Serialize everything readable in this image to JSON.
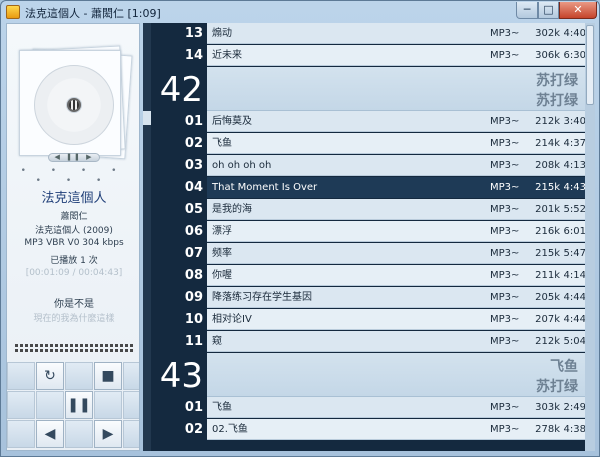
{
  "window": {
    "title": "法克這個人 - 蕭閎仁 [1:09]",
    "minimize": "─",
    "maximize": "□",
    "close": "✕"
  },
  "left": {
    "dots": "• • • • • • •",
    "album_title": "法克這個人",
    "artist": "蕭閎仁",
    "album_year": "法克這個人 (2009)",
    "format": "MP3  VBR V0  304 kbps",
    "plays": "已播放 1 次",
    "faint_line": "[00:01:09 / 00:04:43]",
    "song_name": "你是不是",
    "song_faint": "現在的我為什麼這樣",
    "mini_ctrl": "◀ ❚❚ ▶",
    "controls": {
      "repeat": "↻",
      "stop": "■",
      "pause": "❚❚",
      "prev": "◀",
      "next": "▶"
    }
  },
  "playlist": {
    "top_rows": [
      {
        "num": "13",
        "title": "煽动",
        "format": "MP3~",
        "bitrate": "302k",
        "duration": "4:40"
      },
      {
        "num": "14",
        "title": "近未来",
        "format": "MP3~",
        "bitrate": "306k",
        "duration": "6:30"
      }
    ],
    "group42": {
      "num": "42",
      "line1": "苏打绿",
      "line2": "苏打绿"
    },
    "group42_rows": [
      {
        "num": "01",
        "title": "后悔莫及",
        "format": "MP3~",
        "bitrate": "212k",
        "duration": "3:40"
      },
      {
        "num": "02",
        "title": "飞鱼",
        "format": "MP3~",
        "bitrate": "214k",
        "duration": "4:37"
      },
      {
        "num": "03",
        "title": "oh oh oh oh",
        "format": "MP3~",
        "bitrate": "208k",
        "duration": "4:13"
      },
      {
        "num": "04",
        "title": "That Moment Is Over",
        "format": "MP3~",
        "bitrate": "215k",
        "duration": "4:43"
      },
      {
        "num": "05",
        "title": "是我的海",
        "format": "MP3~",
        "bitrate": "201k",
        "duration": "5:52"
      },
      {
        "num": "06",
        "title": "漂浮",
        "format": "MP3~",
        "bitrate": "216k",
        "duration": "6:01"
      },
      {
        "num": "07",
        "title": "频率",
        "format": "MP3~",
        "bitrate": "215k",
        "duration": "5:47"
      },
      {
        "num": "08",
        "title": "你喔",
        "format": "MP3~",
        "bitrate": "211k",
        "duration": "4:14"
      },
      {
        "num": "09",
        "title": "降落练习存在学生基因",
        "format": "MP3~",
        "bitrate": "205k",
        "duration": "4:44"
      },
      {
        "num": "10",
        "title": "相对论IV",
        "format": "MP3~",
        "bitrate": "207k",
        "duration": "4:44"
      },
      {
        "num": "11",
        "title": "窥",
        "format": "MP3~",
        "bitrate": "212k",
        "duration": "5:04"
      }
    ],
    "group43": {
      "num": "43",
      "line1": "飞鱼",
      "line2": "苏打绿"
    },
    "group43_rows": [
      {
        "num": "01",
        "title": "飞鱼",
        "format": "MP3~",
        "bitrate": "303k",
        "duration": "2:49"
      },
      {
        "num": "02",
        "title": "02.飞鱼",
        "format": "MP3~",
        "bitrate": "278k",
        "duration": "4:38"
      }
    ],
    "selected_index": 3,
    "colors": {
      "selected": "#1e3a56",
      "background": "#14293f",
      "row": "#dbe7f1",
      "group_text": "#6e8193"
    }
  }
}
